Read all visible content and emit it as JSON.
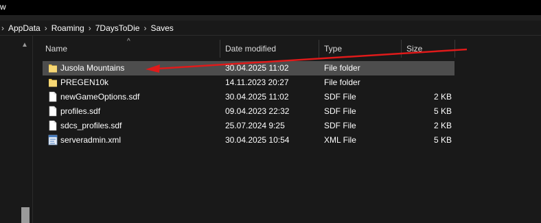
{
  "window": {
    "title_fragment": "w"
  },
  "breadcrumb": {
    "items": [
      "AppData",
      "Roaming",
      "7DaysToDie",
      "Saves"
    ]
  },
  "columns": {
    "name": "Name",
    "date": "Date modified",
    "type": "Type",
    "size": "Size"
  },
  "files": [
    {
      "name": "Jusola Mountains",
      "date": "30.04.2025 11:02",
      "type": "File folder",
      "size": "",
      "icon": "folder-icon",
      "selected": true
    },
    {
      "name": "PREGEN10k",
      "date": "14.11.2023 20:27",
      "type": "File folder",
      "size": "",
      "icon": "folder-icon",
      "selected": false
    },
    {
      "name": "newGameOptions.sdf",
      "date": "30.04.2025 11:02",
      "type": "SDF File",
      "size": "2 KB",
      "icon": "document-icon",
      "selected": false
    },
    {
      "name": "profiles.sdf",
      "date": "09.04.2023 22:32",
      "type": "SDF File",
      "size": "5 KB",
      "icon": "document-icon",
      "selected": false
    },
    {
      "name": "sdcs_profiles.sdf",
      "date": "25.07.2024 9:25",
      "type": "SDF File",
      "size": "2 KB",
      "icon": "document-icon",
      "selected": false
    },
    {
      "name": "serveradmin.xml",
      "date": "30.04.2025 10:54",
      "type": "XML File",
      "size": "5 KB",
      "icon": "xml-file-icon",
      "selected": false
    }
  ],
  "colors": {
    "annotation_arrow": "#e01a1a",
    "folder": "#f2c94c",
    "selection": "#4d4d4d"
  }
}
